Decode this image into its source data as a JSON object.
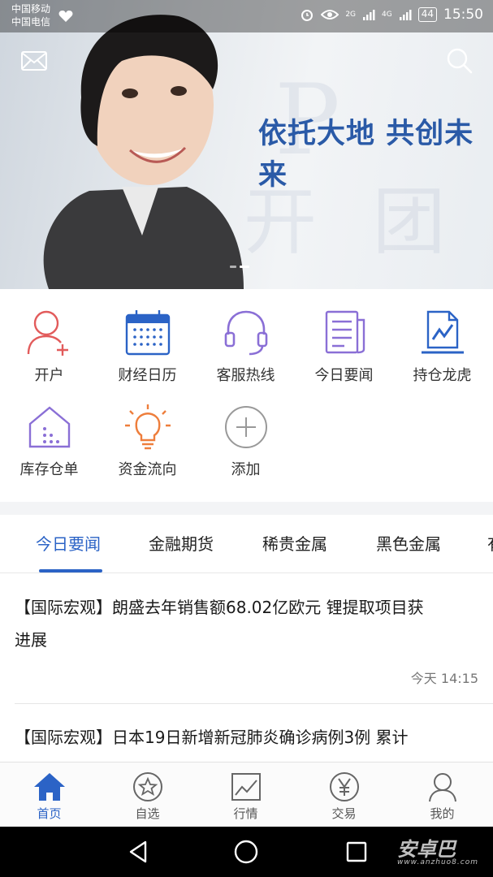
{
  "status_bar": {
    "carrier_1": "中国移动",
    "carrier_2": "中国电信",
    "signal_1": "2G",
    "signal_2": "4G",
    "battery": "44",
    "time": "15:50"
  },
  "banner": {
    "slogan": "依托大地 共创未来",
    "slide_count": 2,
    "active_slide": 1
  },
  "quick_entries": [
    {
      "label": "开户",
      "icon": "add-user-icon"
    },
    {
      "label": "财经日历",
      "icon": "calendar-icon"
    },
    {
      "label": "客服热线",
      "icon": "headset-icon"
    },
    {
      "label": "今日要闻",
      "icon": "newspaper-icon"
    },
    {
      "label": "持仓龙虎",
      "icon": "chart-report-icon"
    },
    {
      "label": "库存仓单",
      "icon": "warehouse-icon"
    },
    {
      "label": "资金流向",
      "icon": "lightbulb-icon"
    },
    {
      "label": "添加",
      "icon": "plus-circle-icon"
    }
  ],
  "tabs": [
    {
      "label": "今日要闻",
      "active": true
    },
    {
      "label": "金融期货",
      "active": false
    },
    {
      "label": "稀贵金属",
      "active": false
    },
    {
      "label": "黑色金属",
      "active": false
    },
    {
      "label": "有",
      "active": false
    }
  ],
  "news": [
    {
      "title_line1": "【国际宏观】朗盛去年销售额68.02亿欧元 锂提取项目获",
      "title_line2": "进展",
      "time": "今天 14:15"
    },
    {
      "title_line1": "【国际宏观】日本19日新增新冠肺炎确诊病例3例 累计",
      "title_line2": "",
      "time": ""
    }
  ],
  "bottom_nav": [
    {
      "label": "首页",
      "icon": "home-icon",
      "active": true
    },
    {
      "label": "自选",
      "icon": "star-circle-icon",
      "active": false
    },
    {
      "label": "行情",
      "icon": "line-chart-icon",
      "active": false
    },
    {
      "label": "交易",
      "icon": "yen-circle-icon",
      "active": false
    },
    {
      "label": "我的",
      "icon": "user-icon",
      "active": false
    }
  ],
  "watermark": {
    "text": "安卓巴",
    "sub": "www.anzhuo8.com"
  },
  "colors": {
    "accent": "#2b63c6",
    "orange": "#ee7e3c",
    "red": "#e25b5b",
    "purple": "#8a6fd6"
  }
}
